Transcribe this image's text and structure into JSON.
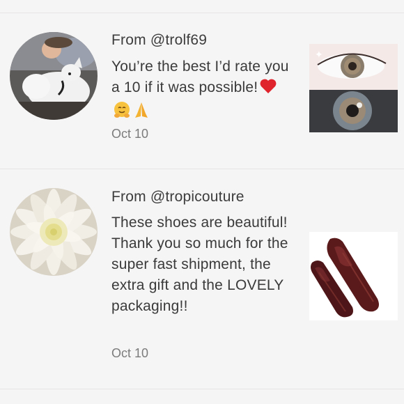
{
  "reviews": [
    {
      "from": "From @trolf69",
      "text": "You’re the best I’d rate you a 10 if it was possible!",
      "emojis": [
        "heart-icon",
        "hugging-face-icon",
        "folded-hands-icon"
      ],
      "date": "Oct 10",
      "avatar": "dog-on-bed-photo",
      "thumbnail": "colored-contact-lens-photo"
    },
    {
      "from": "From @tropicouture",
      "text": "These shoes are beautiful! Thank you so much for the super fast shipment, the extra gift and the LOVELY packaging!!",
      "date": "Oct 10",
      "avatar": "white-dahlia-photo",
      "thumbnail": "burgundy-loafers-photo"
    }
  ],
  "colors": {
    "background": "#f6f5f5",
    "divider": "#e6e4e4",
    "text": "#3a3a3a",
    "date": "#7b7b7b"
  }
}
